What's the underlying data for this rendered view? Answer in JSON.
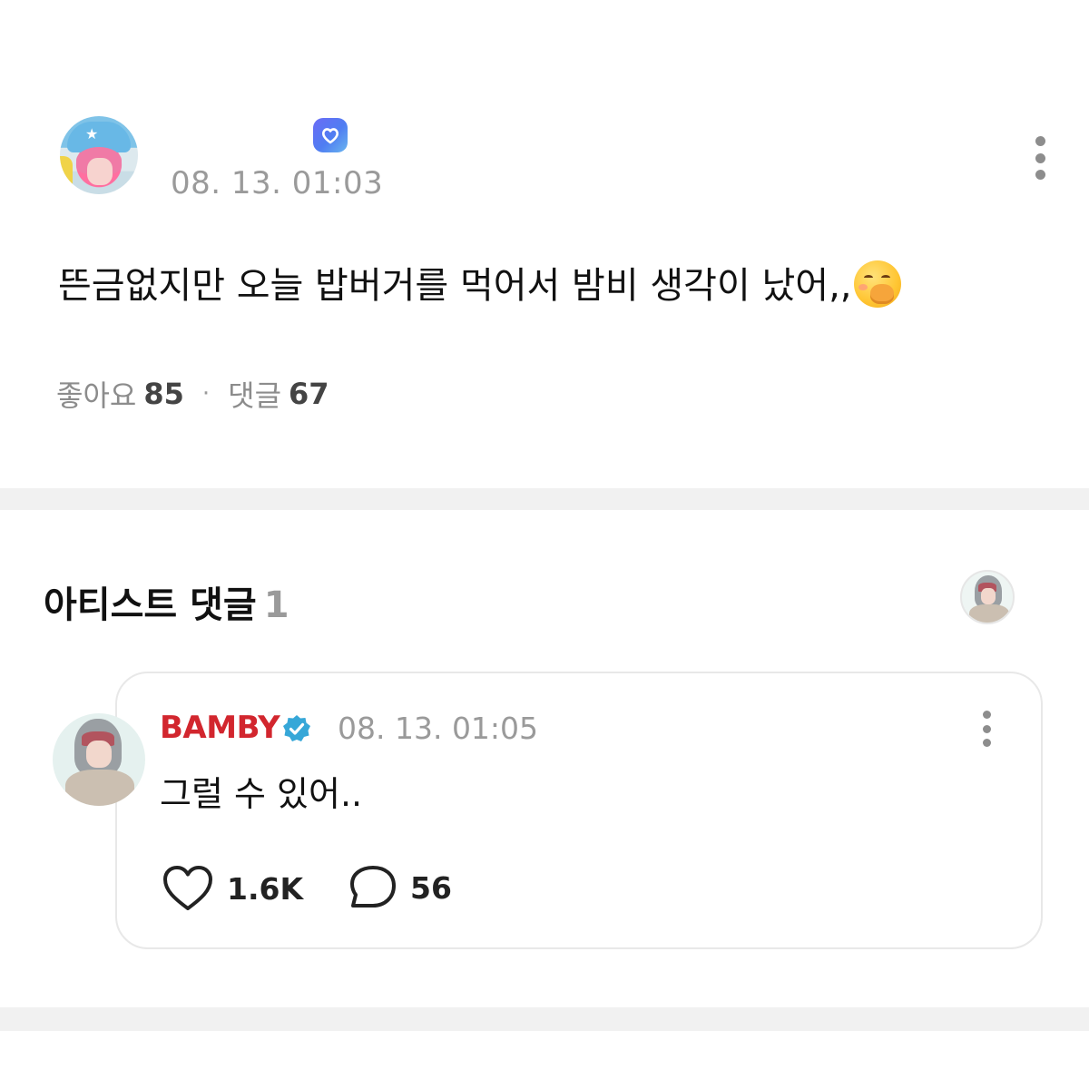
{
  "post": {
    "date": "08. 13. 01:03",
    "text": "뜬금없지만 오늘 밥버거를 먹어서 밤비 생각이 났어,,",
    "emoji_icon": "face-with-hand-over-mouth-icon",
    "stats": {
      "likes_label": "좋아요",
      "likes_count": "85",
      "comments_label": "댓글",
      "comments_count": "67"
    }
  },
  "artist_comments": {
    "title": "아티스트 댓글",
    "count": "1",
    "comment": {
      "author": "BAMBY",
      "date": "08. 13. 01:05",
      "text": "그럴 수 있어..",
      "likes": "1.6K",
      "replies": "56"
    }
  },
  "colors": {
    "artist_name": "#d2262e",
    "verified_badge": "#36a7d8",
    "badge_gradient_start": "#6b6cf6",
    "badge_gradient_end": "#6ab6ef"
  }
}
